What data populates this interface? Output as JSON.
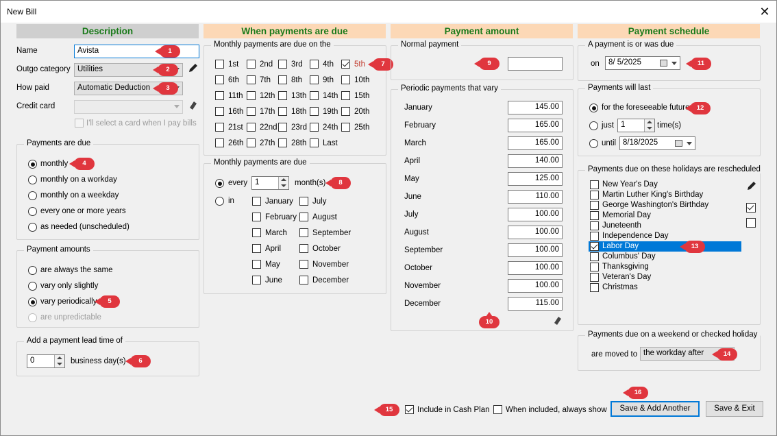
{
  "window": {
    "title": "New Bill",
    "close_glyph": "✕"
  },
  "headers": {
    "description": "Description",
    "due": "When payments are due",
    "amount": "Payment amount",
    "schedule": "Payment schedule"
  },
  "description": {
    "name_label": "Name",
    "name_value": "Avista",
    "outgo_label": "Outgo category",
    "outgo_value": "Utilities",
    "howpaid_label": "How paid",
    "howpaid_value": "Automatic Deduction",
    "card_label": "Credit card",
    "card_value": "",
    "select_card_label": "I'll select a card when I pay bills"
  },
  "payments_due": {
    "title": "Payments are due",
    "options": [
      "monthly",
      "monthly on a workday",
      "monthly on a weekday",
      "every one or more years",
      "as needed (unscheduled)"
    ],
    "selected": 0
  },
  "payment_amounts": {
    "title": "Payment amounts",
    "options": [
      "are always the same",
      "vary only slightly",
      "vary periodically",
      "are unpredictable"
    ],
    "selected": 2
  },
  "lead_time": {
    "title": "Add a payment lead time of",
    "value": "0",
    "unit": "business day(s)"
  },
  "monthly_due_on": {
    "title": "Monthly payments are due on the",
    "days": [
      "1st",
      "2nd",
      "3rd",
      "4th",
      "5th",
      "6th",
      "7th",
      "8th",
      "9th",
      "10th",
      "11th",
      "12th",
      "13th",
      "14th",
      "15th",
      "16th",
      "17th",
      "18th",
      "19th",
      "20th",
      "21st",
      "22nd",
      "23rd",
      "24th",
      "25th",
      "26th",
      "27th",
      "28th",
      "Last"
    ],
    "checked": "5th"
  },
  "monthly_due": {
    "title": "Monthly payments are due",
    "every_label": "every",
    "every_value": "1",
    "every_unit": "month(s)",
    "in_label": "in",
    "months_left": [
      "January",
      "February",
      "March",
      "April",
      "May",
      "June"
    ],
    "months_right": [
      "July",
      "August",
      "September",
      "October",
      "November",
      "December"
    ]
  },
  "normal_payment": {
    "title": "Normal payment",
    "value": ""
  },
  "periodic": {
    "title": "Periodic payments that vary",
    "rows": [
      [
        "January",
        "145.00"
      ],
      [
        "February",
        "165.00"
      ],
      [
        "March",
        "165.00"
      ],
      [
        "April",
        "140.00"
      ],
      [
        "May",
        "125.00"
      ],
      [
        "June",
        "110.00"
      ],
      [
        "July",
        "100.00"
      ],
      [
        "August",
        "100.00"
      ],
      [
        "September",
        "100.00"
      ],
      [
        "October",
        "100.00"
      ],
      [
        "November",
        "100.00"
      ],
      [
        "December",
        "115.00"
      ]
    ]
  },
  "due_date": {
    "title": "A payment is or was due",
    "on_label": "on",
    "value": "8/ 5/2025"
  },
  "will_last": {
    "title": "Payments will last",
    "foreseeable": "for the foreseeable future",
    "just": "just",
    "times_value": "1",
    "times_unit": "time(s)",
    "until": "until",
    "until_value": "8/18/2025"
  },
  "holidays": {
    "title": "Payments due on these holidays are rescheduled",
    "items": [
      "New Year's Day",
      "Martin Luther King's Birthday",
      "George Washington's Birthday",
      "Memorial Day",
      "Juneteenth",
      "Independence Day",
      "Labor Day",
      "Columbus' Day",
      "Thanksgiving",
      "Veteran's Day",
      "Christmas"
    ],
    "checked": "Labor Day"
  },
  "weekend": {
    "title": "Payments due on a weekend or checked holiday",
    "moved_label": "are moved to",
    "moved_value": "the workday after"
  },
  "footer": {
    "include_label": "Include in Cash Plan",
    "always_show_label": "When included, always show",
    "save_add_label": "Save & Add Another",
    "save_exit_label": "Save & Exit"
  },
  "badges": [
    "1",
    "2",
    "3",
    "4",
    "5",
    "6",
    "7",
    "8",
    "9",
    "10",
    "11",
    "12",
    "13",
    "14",
    "15",
    "16"
  ],
  "colors": {
    "header_green": "#1a7a1a",
    "header_orange_bg": "#fcd8b6",
    "header_gray_bg": "#cfcfcf",
    "badge_red": "#e0363e",
    "selection_blue": "#0078d7"
  }
}
